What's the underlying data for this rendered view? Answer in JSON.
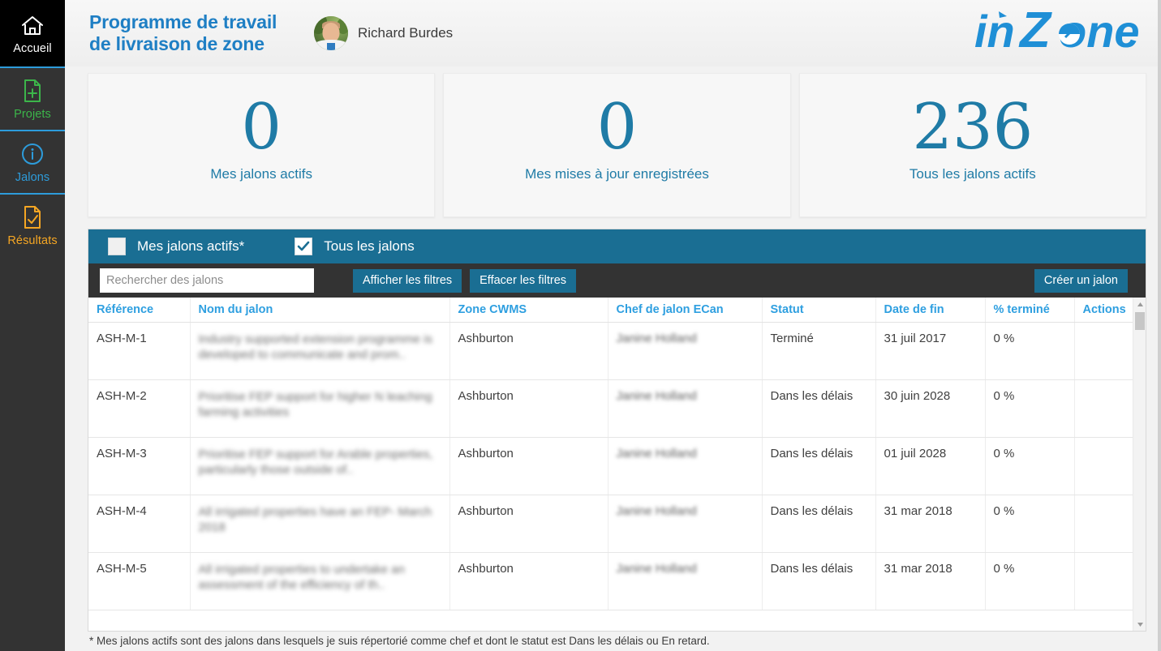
{
  "sidebar": {
    "items": [
      {
        "label": "Accueil",
        "icon": "home-icon",
        "color": "#ffffff"
      },
      {
        "label": "Projets",
        "icon": "document-plus-icon",
        "color": "#3cb54a"
      },
      {
        "label": "Jalons",
        "icon": "info-circle-icon",
        "color": "#2d9cdb"
      },
      {
        "label": "Résultats",
        "icon": "document-check-icon",
        "color": "#f5a623"
      }
    ]
  },
  "header": {
    "title_line1": "Programme de travail",
    "title_line2": "de livraison de zone",
    "user_name": "Richard Burdes",
    "avatar": "user-photo-avatar",
    "brand": "inZone",
    "brand_color": "#1f8fd6",
    "title_color": "#1f7fc4"
  },
  "kpis": [
    {
      "value": "0",
      "label": "Mes jalons actifs"
    },
    {
      "value": "0",
      "label": "Mes mises à jour enregistrées"
    },
    {
      "value": "236",
      "label": "Tous les jalons actifs"
    }
  ],
  "filters": {
    "checkbox_my_label": "Mes jalons actifs*",
    "checkbox_my_checked": false,
    "checkbox_all_label": "Tous les jalons",
    "checkbox_all_checked": true,
    "check_glyph": "✓",
    "search_placeholder": "Rechercher des jalons",
    "search_value": "",
    "btn_show_filters": "Afficher les filtres",
    "btn_clear_filters": "Effacer les filtres",
    "btn_create": "Créer un jalon",
    "bar_color": "#1a6e93",
    "bar2_color": "#333333"
  },
  "table": {
    "columns": [
      "Référence",
      "Nom du jalon",
      "Zone CWMS",
      "Chef de jalon ECan",
      "Statut",
      "Date de fin",
      "% terminé",
      "Actions"
    ],
    "header_color": "#2e9fe0",
    "rows": [
      {
        "reference": "ASH-M-1",
        "name": "Industry supported extension programme is developed to communicate and prom..",
        "zone": "Ashburton",
        "chef": "Janine Holland",
        "statut": "Terminé",
        "date_fin": "31 juil 2017",
        "percent": "0 %",
        "actions": ""
      },
      {
        "reference": "ASH-M-2",
        "name": "Prioritise FEP support for higher N leaching farming activities",
        "zone": "Ashburton",
        "chef": "Janine Holland",
        "statut": "Dans les délais",
        "date_fin": "30 juin 2028",
        "percent": "0 %",
        "actions": ""
      },
      {
        "reference": "ASH-M-3",
        "name": "Prioritise FEP support for Arable properties, particularly those outside of..",
        "zone": "Ashburton",
        "chef": "Janine Holland",
        "statut": "Dans les délais",
        "date_fin": "01 juil 2028",
        "percent": "0 %",
        "actions": ""
      },
      {
        "reference": "ASH-M-4",
        "name": "All irrigated properties have an FEP- March 2018",
        "zone": "Ashburton",
        "chef": "Janine Holland",
        "statut": "Dans les délais",
        "date_fin": "31 mar 2018",
        "percent": "0 %",
        "actions": ""
      },
      {
        "reference": "ASH-M-5",
        "name": "All irrigated properties to undertake an assessment of the efficiency of th..",
        "zone": "Ashburton",
        "chef": "Janine Holland",
        "statut": "Dans les délais",
        "date_fin": "31 mar 2018",
        "percent": "0 %",
        "actions": ""
      }
    ]
  },
  "footnote": "* Mes jalons actifs sont des jalons dans lesquels je suis répertorié comme chef et dont le statut est Dans les délais ou En retard."
}
